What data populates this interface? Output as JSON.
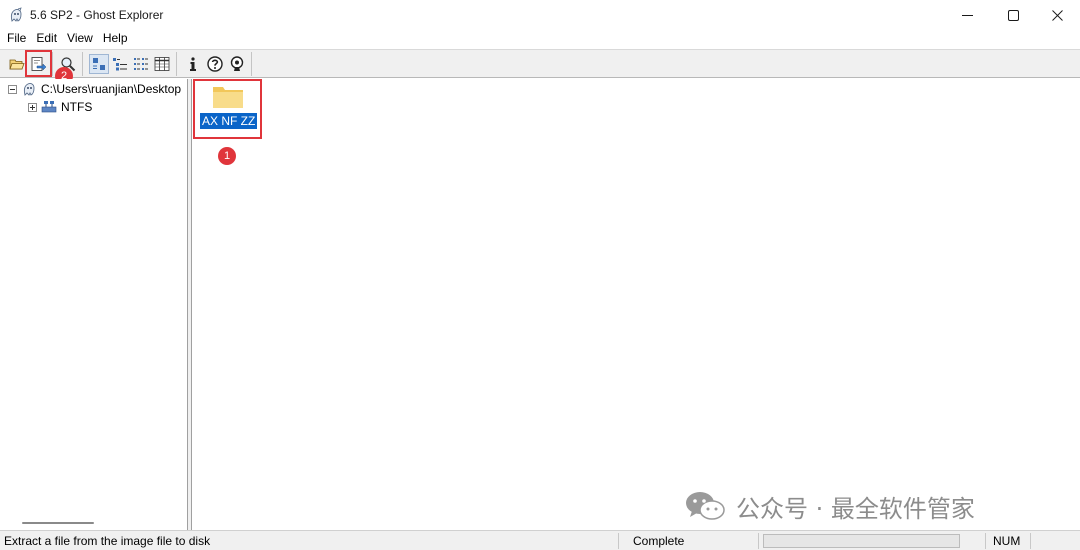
{
  "window": {
    "title": "5.6 SP2 - Ghost Explorer",
    "icon": "ghost-app-icon",
    "controls": [
      "minimize",
      "maximize",
      "close"
    ]
  },
  "menu": [
    "File",
    "Edit",
    "View",
    "Help"
  ],
  "toolbar": {
    "buttons": [
      {
        "name": "open-icon",
        "tooltip": ""
      },
      {
        "name": "extract-icon",
        "tooltip": ""
      },
      {
        "name": "find-icon",
        "tooltip": ""
      },
      {
        "name": "large-icons-view-icon",
        "tooltip": "",
        "pressed": true
      },
      {
        "name": "small-icons-view-icon",
        "tooltip": ""
      },
      {
        "name": "list-view-icon",
        "tooltip": ""
      },
      {
        "name": "details-view-icon",
        "tooltip": ""
      },
      {
        "name": "properties-icon",
        "tooltip": ""
      },
      {
        "name": "help-icon",
        "tooltip": ""
      },
      {
        "name": "about-icon",
        "tooltip": ""
      }
    ]
  },
  "annotations": {
    "badge_1": "1",
    "badge_2": "2",
    "color": "#e0353b"
  },
  "tree": {
    "root_label": "C:\\Users\\ruanjian\\Desktop",
    "child_label": "NTFS"
  },
  "content": {
    "items": [
      {
        "label": "AX NF ZZ",
        "type": "folder",
        "selected": true
      }
    ]
  },
  "watermark": {
    "text": "公众号 · 最全软件管家"
  },
  "statusbar": {
    "message": "Extract a file from the image file to disk",
    "state": "Complete",
    "num": "NUM"
  },
  "colors": {
    "selection": "#0a64c8",
    "folder": "#f6d67a",
    "annotation_red": "#e0353b"
  }
}
